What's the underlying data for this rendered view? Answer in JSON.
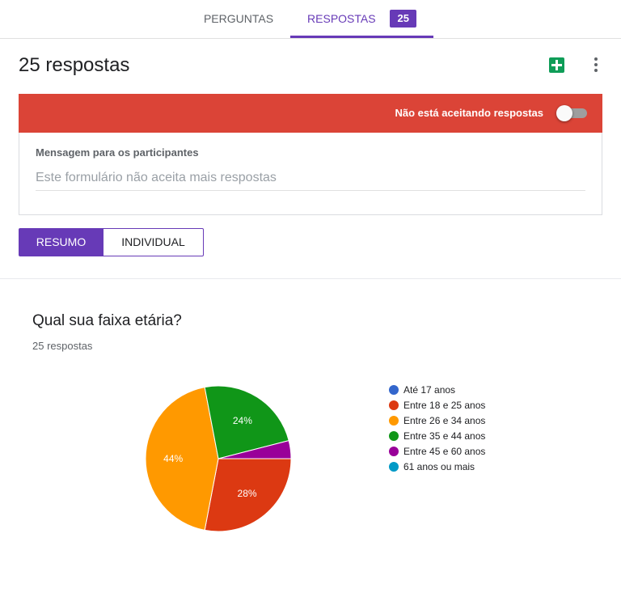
{
  "tabs": [
    {
      "label": "PERGUNTAS",
      "active": false
    },
    {
      "label": "RESPOSTAS",
      "active": true,
      "badge": "25"
    }
  ],
  "header": {
    "title": "25 respostas",
    "sheets_icon": "google-sheets-icon",
    "more_icon": "more-vert-icon"
  },
  "accepting": {
    "label": "Não está aceitando respostas",
    "enabled": false,
    "bar_color": "#db4437",
    "message_label": "Mensagem para os participantes",
    "message_placeholder": "Este formulário não aceita mais respostas"
  },
  "view_toggle": {
    "summary": "RESUMO",
    "individual": "INDIVIDUAL",
    "selected": "summary"
  },
  "accent_color": "#673ab7",
  "question": {
    "title": "Qual sua faixa etária?",
    "count": "25 respostas"
  },
  "chart_data": {
    "type": "pie",
    "title": "",
    "categories": [
      "Até 17 anos",
      "Entre 18 e 25 anos",
      "Entre 26 e 34 anos",
      "Entre 35 e 44 anos",
      "Entre 45 e 60 anos",
      "61 anos ou mais"
    ],
    "values": [
      0,
      28,
      44,
      24,
      4,
      0
    ],
    "value_labels": [
      "",
      "28%",
      "44%",
      "24%",
      "",
      ""
    ],
    "colors": [
      "#3366cc",
      "#dc3912",
      "#ff9900",
      "#109618",
      "#990099",
      "#0099c6"
    ],
    "legend": "right"
  }
}
